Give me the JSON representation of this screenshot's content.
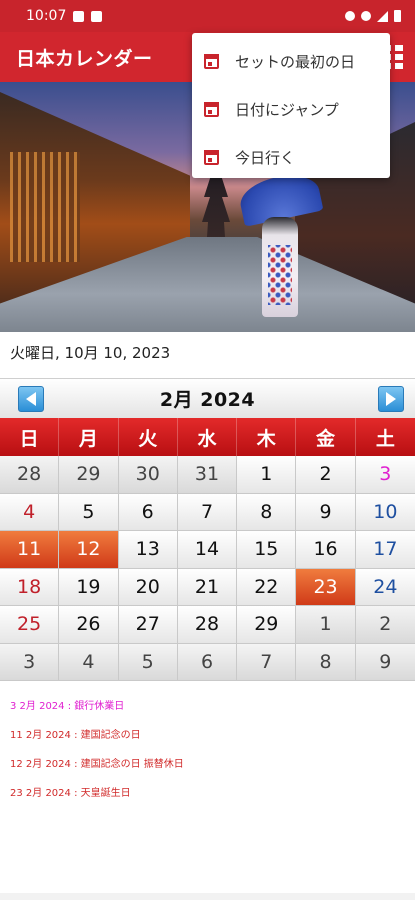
{
  "status_bar": {
    "time": "10:07"
  },
  "app_bar": {
    "title": "日本カレンダー"
  },
  "menu": {
    "items": [
      {
        "label": "セットの最初の日"
      },
      {
        "label": "日付にジャンプ"
      },
      {
        "label": "今日行く"
      }
    ]
  },
  "current_date": "火曜日, 10月 10, 2023",
  "calendar": {
    "month_label": "2月  2024",
    "weekdays": [
      "日",
      "月",
      "火",
      "水",
      "木",
      "金",
      "土"
    ],
    "days": [
      "28",
      "29",
      "30",
      "31",
      "1",
      "2",
      "3",
      "4",
      "5",
      "6",
      "7",
      "8",
      "9",
      "10",
      "11",
      "12",
      "13",
      "14",
      "15",
      "16",
      "17",
      "18",
      "19",
      "20",
      "21",
      "22",
      "23",
      "24",
      "25",
      "26",
      "27",
      "28",
      "29",
      "1",
      "2",
      "3",
      "4",
      "5",
      "6",
      "7",
      "8",
      "9"
    ]
  },
  "holidays": [
    {
      "text": "3 2月 2024 : 銀行休業日",
      "color": "#e020d0"
    },
    {
      "text": "11 2月 2024 : 建国記念の日",
      "color": "#d12a2a"
    },
    {
      "text": "12 2月 2024 : 建国記念の日 振替休日",
      "color": "#d12a2a"
    },
    {
      "text": "23 2月 2024 : 天皇誕生日",
      "color": "#d12a2a"
    }
  ],
  "colors": {
    "app_bar": "#d1262e",
    "status_bar": "#c8242c",
    "highlight": "#e0552a",
    "sunday": "#c0202a",
    "saturday": "#1e4fa0"
  }
}
